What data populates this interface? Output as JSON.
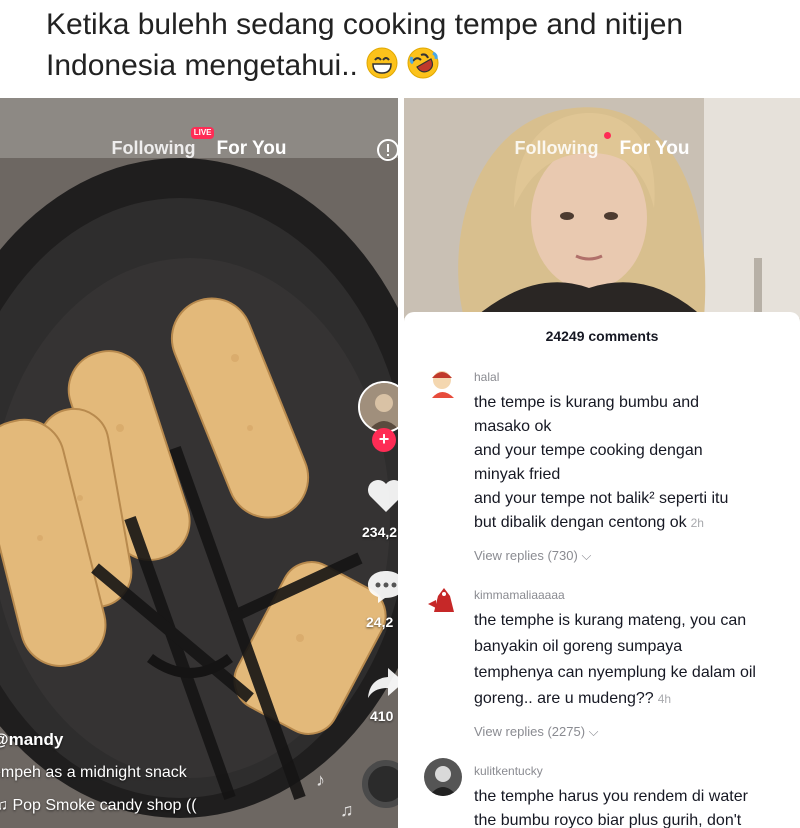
{
  "caption": {
    "text": "Ketika bulehh sedang cooking tempe and nitijen Indonesia mengetahui..",
    "emoji_icons": [
      "grinning-face-icon",
      "rolling-laughing-face-icon"
    ]
  },
  "left_video": {
    "nav": {
      "following": "Following",
      "live_badge": "LIVE",
      "for_you": "For You"
    },
    "actions": {
      "likes": "234,2",
      "comments": "24,2",
      "shares": "410"
    },
    "user": "@mandy",
    "description": "empeh as a midnight snack",
    "music": "Pop Smoke candy shop (("
  },
  "right_video": {
    "nav": {
      "following": "Following",
      "for_you": "For You"
    },
    "comments_panel": {
      "title": "24249 comments",
      "comments": [
        {
          "user": "halal",
          "lines": [
            "the tempe is kurang bumbu and",
            "masako ok",
            "and your tempe cooking dengan",
            "minyak fried",
            "and your tempe not balik² seperti itu",
            "but dibalik dengan centong ok"
          ],
          "time": "2h",
          "replies": "View replies (730)"
        },
        {
          "user": "kimmamaliaaaaa",
          "lines": [
            "the temphe is kurang mateng, you can",
            "banyakin oil goreng sumpaya",
            "temphenya can nyemplung ke dalam oil",
            "goreng.. are u mudeng??"
          ],
          "time": "4h",
          "replies": "View replies (2275)"
        },
        {
          "user": "kulitkentucky",
          "lines": [
            "the temphe harus you rendem di water",
            "the bumbu royco biar plus gurih, don't"
          ],
          "time": "",
          "replies": ""
        }
      ]
    }
  },
  "colors": {
    "tiktok_red": "#fe2c55",
    "pan": "#2b2a2a",
    "tempe": "#e3b97a"
  }
}
